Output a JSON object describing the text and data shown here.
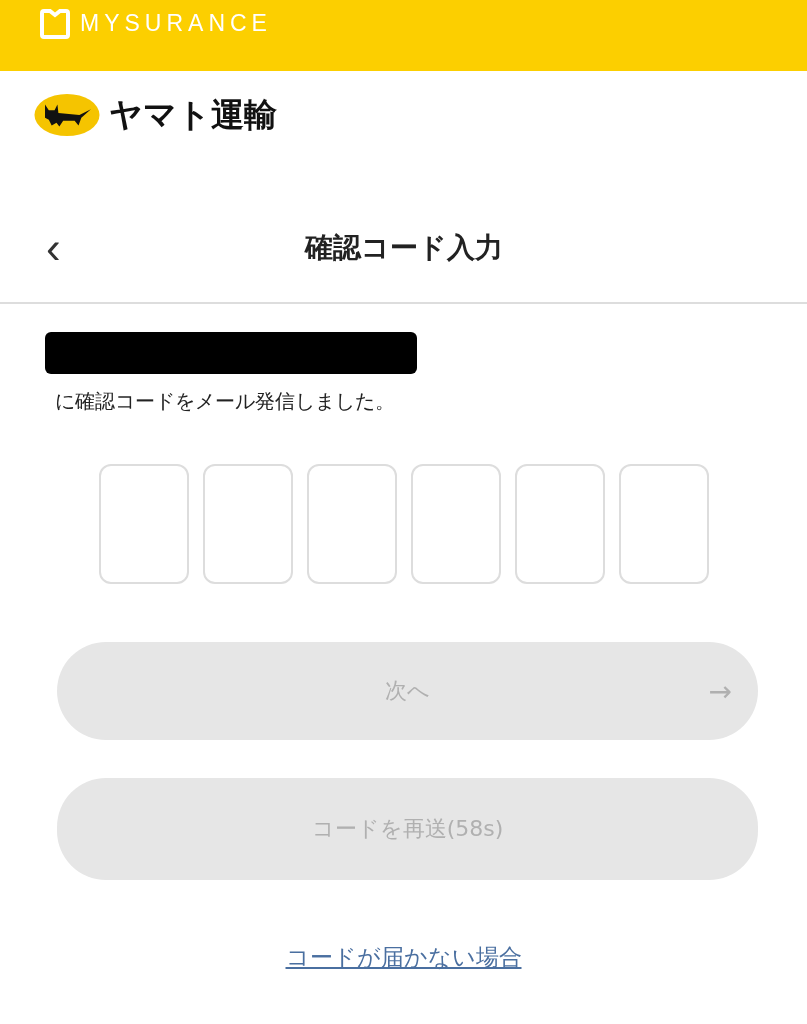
{
  "brand": {
    "name": "MYSURANCE"
  },
  "partner": {
    "name": "ヤマト運輸"
  },
  "header": {
    "back": "‹",
    "title": "確認コード入力"
  },
  "message": {
    "redacted": true,
    "text": "に確認コードをメール発信しました。"
  },
  "code_boxes": [
    {
      "filled": false
    },
    {
      "filled": false
    },
    {
      "filled": false
    },
    {
      "filled": false
    },
    {
      "filled": false
    },
    {
      "filled": false
    }
  ],
  "buttons": [
    {
      "kind": "next",
      "label": "次へ",
      "arrow": "→",
      "disabled": true
    },
    {
      "kind": "resend",
      "label": "コードを再送(58s)",
      "disabled": true
    }
  ],
  "link": "コードが届かない場合"
}
